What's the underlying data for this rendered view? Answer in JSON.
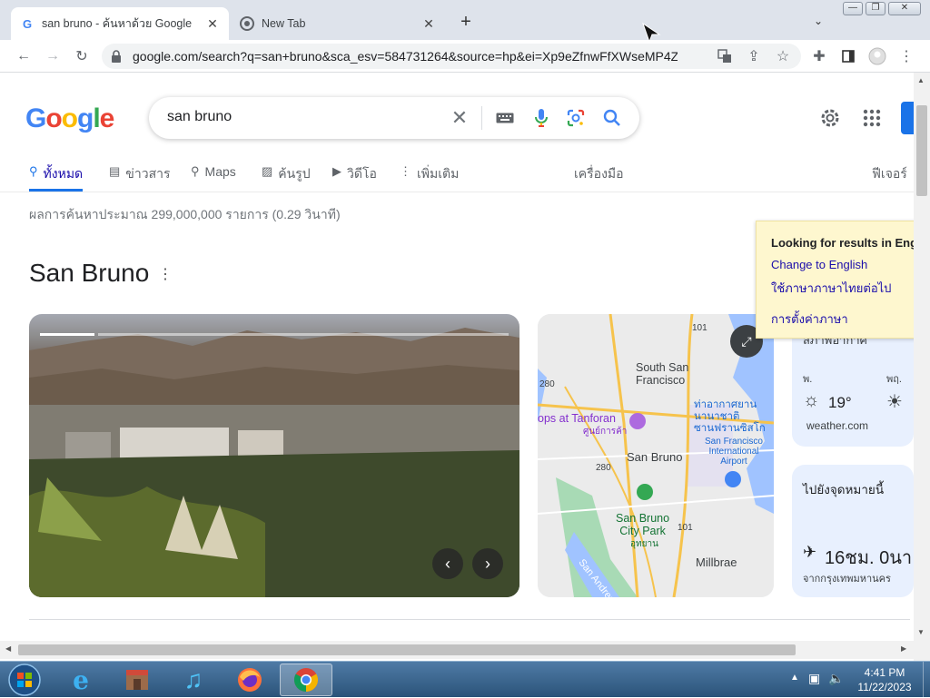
{
  "window": {
    "tabs": [
      {
        "title": "san bruno - ค้นหาด้วย Google",
        "active": true
      },
      {
        "title": "New Tab",
        "active": false
      }
    ],
    "new_tab_label": "+",
    "controls": {
      "minimize": "—",
      "restore": "❐",
      "close": "✕"
    }
  },
  "toolbar": {
    "url": "google.com/search?q=san+bruno&sca_esv=584731264&source=hp&ei=Xp9eZfnwFfXWseMP4Z25..."
  },
  "page": {
    "logo_letters": [
      {
        "char": "G",
        "color": "#4285F4"
      },
      {
        "char": "o",
        "color": "#EA4335"
      },
      {
        "char": "o",
        "color": "#FBBC05"
      },
      {
        "char": "g",
        "color": "#4285F4"
      },
      {
        "char": "l",
        "color": "#34A853"
      },
      {
        "char": "e",
        "color": "#EA4335"
      }
    ],
    "search": {
      "query": "san bruno"
    },
    "nav": {
      "all": "ทั้งหมด",
      "news": "ข่าวสาร",
      "maps": "Maps",
      "images": "ค้นรูป",
      "videos": "วิดีโอ",
      "more": "เพิ่มเติม",
      "tools": "เครื่องมือ",
      "features": "ฟีเจอร์"
    },
    "stats": "ผลการค้นหาประมาณ 299,000,000 รายการ (0.29 วินาที)",
    "knowledge_panel": {
      "title": "San Bruno",
      "map_labels": {
        "south_sf": "South San\nFrancisco",
        "tanforan": "ops at Tanforan",
        "tanforan_th": "ศูนย์การค้า",
        "airport_th": "ท่าอากาศยาน\nนานาชาติ\nซานฟรานซิสโก",
        "airport_en": "San Francisco\nInternational\nAirport",
        "san_bruno": "San Bruno",
        "park": "San Bruno\nCity Park",
        "park_th": "อุทยาน",
        "millbrae": "Millbrae",
        "san_andreas": "San Andreas L",
        "hwy_101_top": "101",
        "hwy_280_a": "280",
        "hwy_280_b": "280",
        "hwy_101_bot": "101"
      },
      "weather": {
        "header": "สภาพอากาศ",
        "day1": "พ.",
        "day2": "พฤ.",
        "temp": "19°",
        "source": "weather.com"
      },
      "travel": {
        "title": "ไปยังจุดหมายนี้",
        "duration": "16ชม. 0นา",
        "from": "จากกรุงเทพมหานคร"
      }
    },
    "language_popup": {
      "title": "Looking for results in Eng",
      "change": "Change to English",
      "keep_thai": "ใช้ภาษาภาษาไทยต่อไป",
      "settings": "การตั้งค่าภาษา"
    }
  },
  "taskbar": {
    "time": "4:41 PM",
    "date": "11/22/2023"
  }
}
